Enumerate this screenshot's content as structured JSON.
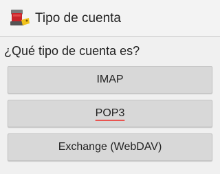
{
  "window": {
    "title": "Tipo de cuenta",
    "icon": "email-app-icon"
  },
  "content": {
    "question": "¿Qué tipo de cuenta es?",
    "buttons": [
      {
        "label": "IMAP"
      },
      {
        "label": "POP3",
        "spellcheck_underline": true
      },
      {
        "label": "Exchange (WebDAV)"
      }
    ]
  },
  "colors": {
    "background": "#f0f0f0",
    "button_bg": "#d8d8d8",
    "spellcheck_underline": "#e85450"
  }
}
